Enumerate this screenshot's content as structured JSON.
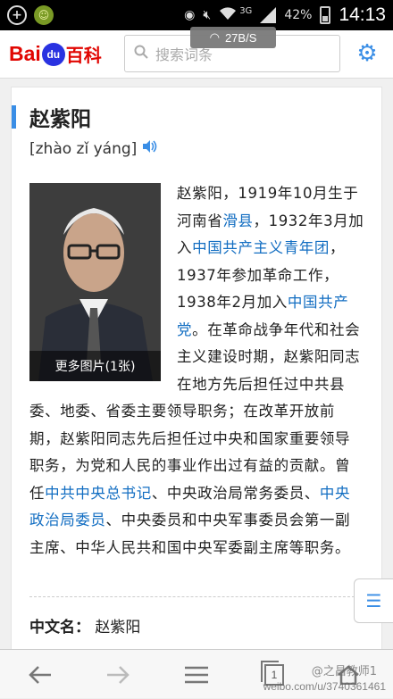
{
  "status_bar": {
    "battery_percent": "42%",
    "network_type": "3G",
    "time": "14:13",
    "net_speed": "27B/S"
  },
  "header": {
    "logo_bai": "Bai",
    "logo_du": "du",
    "logo_baike": "百科",
    "search_placeholder": "搜索词条",
    "accent_color": "#3a8ee6"
  },
  "article": {
    "title": "赵紫阳",
    "pinyin": "[zhào zǐ yáng]",
    "photo_caption": "更多图片(1张)",
    "summary": [
      {
        "text": "赵紫阳，1919年10月生于河南省"
      },
      {
        "text": "滑县",
        "link": true
      },
      {
        "text": "，1932年3月加入"
      },
      {
        "text": "中国共产主义青年团",
        "link": true
      },
      {
        "text": "，1937年参加革命工作，1938年2月加入"
      },
      {
        "text": "中国共产党",
        "link": true
      },
      {
        "text": "。在革命战争年代和社会主义建设时期，赵紫阳同志在地方先后担任过中共县委、地委、省委主要领导职务；在改革开放前期，赵紫阳同志先后担任过中央和国家重要领导职务，为党和人民的事业作出过有益的贡献。曾任"
      },
      {
        "text": "中共中央总书记",
        "link": true
      },
      {
        "text": "、中央政治局常务委员、"
      },
      {
        "text": "中央政治局委员",
        "link": true
      },
      {
        "text": "、中央委员和中央军事委员会第一副主席、中华人民共和国中央军委副主席等职务。"
      }
    ],
    "info": {
      "label": "中文名：",
      "value": "赵紫阳"
    }
  },
  "bottom_nav": {
    "tab_count": "1"
  },
  "watermark": {
    "line1": "@之昌教师1",
    "line2": "weibo.com/u/3740361461"
  },
  "icons": [
    "plus-circle-icon",
    "smiley-icon",
    "eye-icon",
    "mute-icon",
    "wifi-icon",
    "signal-icon",
    "battery-icon",
    "search-icon",
    "settings-icon",
    "speaker-icon",
    "list-icon",
    "back-arrow-icon",
    "forward-arrow-icon",
    "menu-icon",
    "tabs-icon",
    "home-icon"
  ]
}
